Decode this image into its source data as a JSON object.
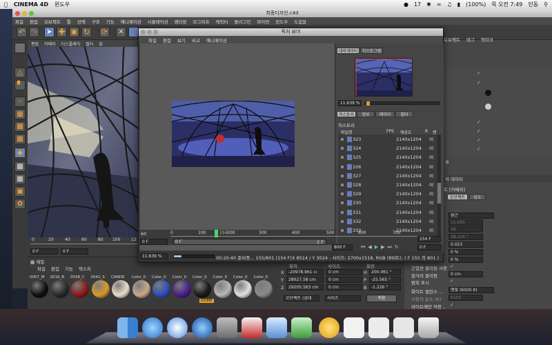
{
  "menubar": {
    "app": "CINEMA 4D",
    "items": [
      "윈도우"
    ],
    "status": {
      "count": "17",
      "battery": "(100%)",
      "clock": "목 오전 7:49",
      "user": "민동"
    }
  },
  "main_window": {
    "title": "최종디자인.c4d",
    "menu": [
      "파일",
      "편집",
      "오브젝트",
      "툴",
      "선택",
      "구조",
      "기능",
      "애니메이션",
      "시뮬레이션",
      "렌더링",
      "모그라프",
      "캐릭터",
      "플러그인",
      "파이썬",
      "윈도우",
      "도움말"
    ]
  },
  "viewport": {
    "menu": [
      "편집",
      "카메라",
      "디스플레이",
      "필터",
      "뷰"
    ],
    "ruler": [
      "0",
      "20",
      "40",
      "60",
      "80",
      "100",
      "12"
    ],
    "frame_start": "0 F",
    "frame_current": "0 F"
  },
  "materials": {
    "tab": "재질",
    "menu": [
      "파일",
      "편집",
      "기능",
      "텍스처"
    ],
    "items": [
      {
        "label": "0007_M",
        "color": "#101010"
      },
      {
        "label": "0018_B",
        "color": "#2a2a2a"
      },
      {
        "label": "0038_C",
        "color": "#8b1a1a"
      },
      {
        "label": "0042_S",
        "color": "#d89a2c"
      },
      {
        "label": "CANDE",
        "color": "#e8dcc8"
      },
      {
        "label": "Color_0",
        "color": "#c9a88c"
      },
      {
        "label": "Color_0",
        "color": "#2e4fb8"
      },
      {
        "label": "Color_0",
        "color": "#4b1f8c"
      },
      {
        "label": "Color_0",
        "color": "#1a1a1a"
      },
      {
        "label": "Color_0",
        "color": "#b7b7b7"
      },
      {
        "label": "Color_0",
        "color": "#e0e0e0"
      },
      {
        "label": "Color_0",
        "color": "#8a8a8a"
      }
    ],
    "dome_label": "DOME"
  },
  "coords": {
    "headers": [
      "위치",
      "사이즈",
      "회전"
    ],
    "rows": [
      {
        "axis": "X",
        "pos": "-20978.961 cı",
        "size": "0 cm",
        "rot_axis": "H",
        "rot": "200.061 °"
      },
      {
        "axis": "Y",
        "pos": "28027.58 cm",
        "size": "0 cm",
        "rot_axis": "P",
        "rot": "-25.565 °"
      },
      {
        "axis": "Z",
        "pos": "29205.563 cm",
        "size": "0 cm",
        "rot_axis": "B",
        "rot": "-1.226 °"
      }
    ],
    "mode_select": "오브젝트 (상대",
    "size_select": "사이즈",
    "apply": "적용"
  },
  "right_panel": {
    "menu": [
      "오브젝트",
      "태그",
      "북마크"
    ],
    "attr_title": "처 데이터",
    "attr_tabs": [
      "오브젝트",
      "상도"
    ],
    "attr_label": "트 [카메라]",
    "projection": "원근",
    "values": [
      "15.685",
      "36",
      "38.224 °",
      "0.023",
      "0 %",
      "0 %"
    ],
    "clipping_label": "근접면 클리핑 사용",
    "clip_value": "0 cm",
    "far_label": "원거리 클리핑",
    "scope_label": "범위 표시",
    "wb_label": "화이트 밸런스 ...",
    "wb_value": "햇빛 (6500 K)",
    "temp_label": "사용자 온도 (K)",
    "temp_value": "6500",
    "lights_label": "라이트에만 적용 ..",
    "side_letter": "B"
  },
  "picture_viewer": {
    "title": "픽처 뷰어",
    "menu": [
      "파일",
      "편집",
      "보기",
      "비교",
      "애니메이션"
    ],
    "nav_tabs": [
      "네비게이터",
      "히스토그램"
    ],
    "zoom": "11.639 %",
    "info_tabs": [
      "히스토리",
      "정보",
      "레이어",
      "필터"
    ],
    "history_label": "히스토리",
    "columns": {
      "name": "파일명",
      "fps": "FPS",
      "res": "해상도",
      "r": "R",
      "e": "렌"
    },
    "rows": [
      {
        "num": "323",
        "res": "2140x1204",
        "oc": "0("
      },
      {
        "num": "324",
        "res": "2140x1204",
        "oc": "0("
      },
      {
        "num": "325",
        "res": "2140x1204",
        "oc": "0("
      },
      {
        "num": "326",
        "res": "2140x1204",
        "oc": "0("
      },
      {
        "num": "327",
        "res": "2140x1204",
        "oc": "0("
      },
      {
        "num": "328",
        "res": "2140x1204",
        "oc": "0("
      },
      {
        "num": "329",
        "res": "2140x1204",
        "oc": "0("
      },
      {
        "num": "330",
        "res": "2140x1204",
        "oc": "0("
      },
      {
        "num": "331",
        "res": "2140x1204",
        "oc": "0("
      },
      {
        "num": "332",
        "res": "2140x1204",
        "oc": "0("
      },
      {
        "num": "333",
        "res": "2140x1204",
        "oc": "0("
      }
    ],
    "timeline": {
      "fps": "60",
      "ticks": [
        "0",
        "100",
        "200",
        "300",
        "400",
        "500",
        "600",
        "700"
      ],
      "current_marker": "154",
      "frame_start": "0 F",
      "frame_mid": "0 F",
      "frame_end_l": "2 F",
      "frame_end": "800 F",
      "frame_right": "154 F",
      "frame_right2": "0 F"
    },
    "status": {
      "zoom": "11.639 %",
      "elapsed": "00:20:40 준비중... 155/801 (154 F)",
      "coords": "X 8514 / Y 3024 - 사이즈: 2700x1518, RGB (8비트), ( F 155 의 801 )"
    }
  },
  "dock": {
    "items": [
      "finder",
      "itunes",
      "safari",
      "earth",
      "preferences",
      "scripts",
      "preview",
      "photos",
      "rabbit",
      "doc1",
      "doc2",
      "doc3",
      "trash"
    ]
  }
}
